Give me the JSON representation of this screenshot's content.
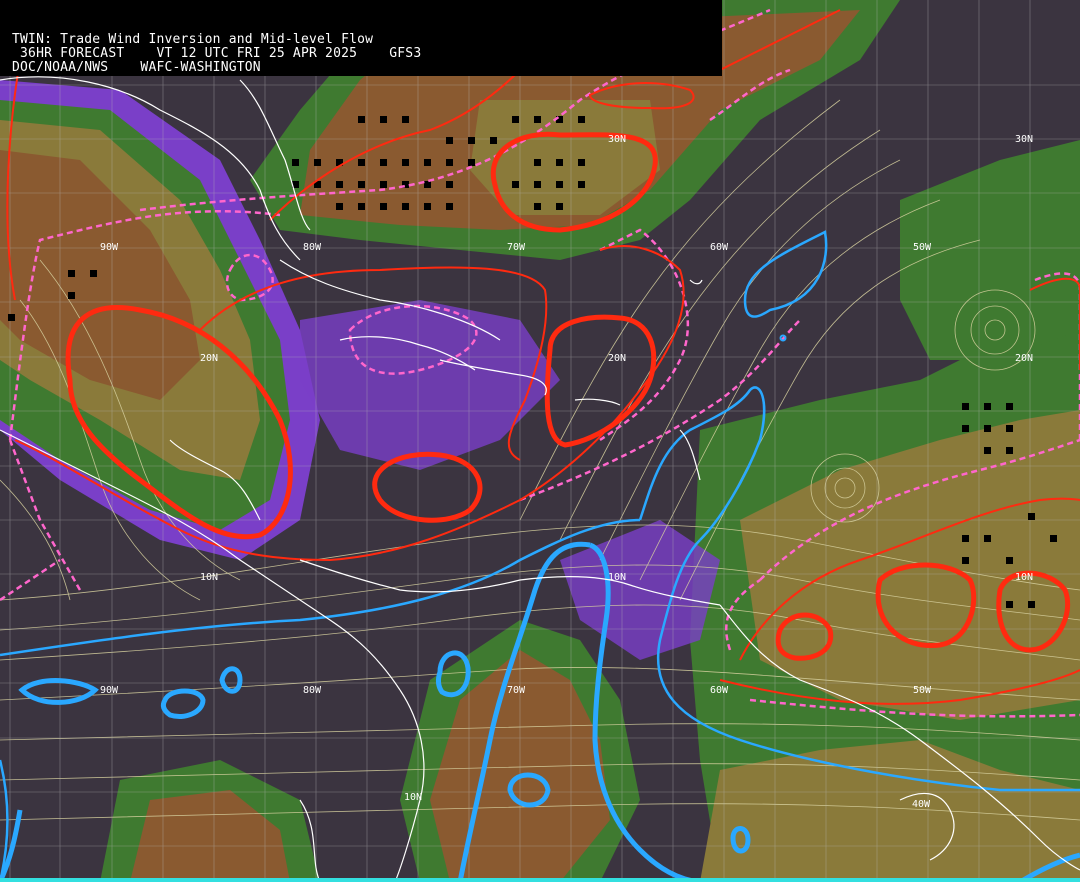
{
  "header": {
    "line1": "TWIN: Trade Wind Inversion and Mid-level Flow",
    "line2": " 36HR FORECAST    VT 12 UTC FRI 25 APR 2025    GFS3",
    "line3": "DOC/NOAA/NWS    WAFC-WASHINGTON"
  },
  "latitude_labels": [
    "30N",
    "30N",
    "20N",
    "20N",
    "20N",
    "10N",
    "10N",
    "10N",
    "10N"
  ],
  "longitude_labels": [
    "90W",
    "80W",
    "70W",
    "60W",
    "50W",
    "90W",
    "80W",
    "70W",
    "60W",
    "50W",
    "40W"
  ],
  "colors": {
    "background_dark": "#3b3440",
    "dark_blue": "#3f3f86",
    "violet": "#7a3fc8",
    "green": "#3f7a30",
    "olive": "#8a7a3a",
    "brown": "#8a5a30",
    "inversion_contour": "#ff2a10",
    "dashed_contour": "#ff66cc",
    "cyan_contour": "#2aa8ff",
    "streamlines": "#d8d2a0",
    "coastlines": "#ffffff",
    "bottom_bar": "#33e0e0"
  }
}
